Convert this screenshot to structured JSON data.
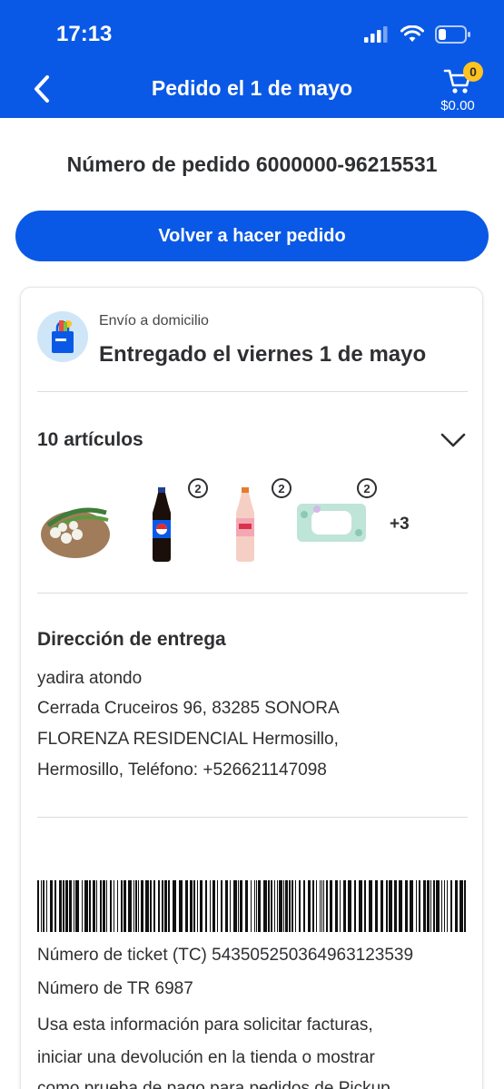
{
  "status_bar": {
    "time": "17:13"
  },
  "header": {
    "title": "Pedido el 1 de mayo",
    "cart_count": "0",
    "cart_total": "$0.00"
  },
  "order": {
    "number_text": "Número de pedido 6000000-96215531",
    "reorder_label": "Volver a hacer pedido"
  },
  "shipping": {
    "label": "Envío a domicilio",
    "status": "Entregado el viernes 1 de mayo"
  },
  "items": {
    "count_label": "10 artículos",
    "thumbnails": [
      {
        "name": "cebollas",
        "qty": ""
      },
      {
        "name": "pepsi",
        "qty": "2"
      },
      {
        "name": "refresco-rosa",
        "qty": "2"
      },
      {
        "name": "toallitas",
        "qty": "2"
      }
    ],
    "more_label": "+3"
  },
  "address": {
    "title": "Dirección de entrega",
    "lines": [
      "yadira atondo",
      "Cerrada Cruceiros 96, 83285 SONORA",
      "FLORENZA RESIDENCIAL Hermosillo,",
      "Hermosillo, Teléfono: +526621147098"
    ]
  },
  "ticket": {
    "tc_text": "Número de ticket (TC) 543505250364963123539",
    "tr_text": "Número de TR 6987",
    "info_lines": [
      "Usa esta información para solicitar facturas,",
      "iniciar una devolución en la tienda o mostrar",
      "como prueba de pago para pedidos de Pickup"
    ]
  },
  "colors": {
    "brand_blue": "#0a59e6",
    "badge_yellow": "#ffc220",
    "text": "#2e2f32"
  },
  "icons": [
    "back-arrow-icon",
    "cart-icon",
    "signal-icon",
    "wifi-icon",
    "battery-icon",
    "shopping-bag-icon",
    "chevron-down-icon",
    "barcode-icon"
  ]
}
